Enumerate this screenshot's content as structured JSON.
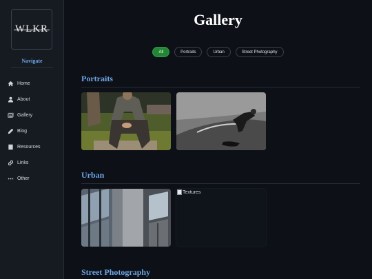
{
  "sidebar": {
    "logo_text": "WLKR",
    "nav_title": "Navigate",
    "items": [
      {
        "label": "Home",
        "icon": "home-icon"
      },
      {
        "label": "About",
        "icon": "user-icon"
      },
      {
        "label": "Gallery",
        "icon": "gallery-icon"
      },
      {
        "label": "Blog",
        "icon": "pencil-icon"
      },
      {
        "label": "Resources",
        "icon": "book-icon"
      },
      {
        "label": "Links",
        "icon": "link-icon"
      },
      {
        "label": "Other",
        "icon": "ellipsis-icon"
      }
    ]
  },
  "main": {
    "title": "Gallery",
    "filters": [
      {
        "label": "All",
        "active": true
      },
      {
        "label": "Portraits",
        "active": false
      },
      {
        "label": "Urban",
        "active": false
      },
      {
        "label": "Street Photography",
        "active": false
      }
    ],
    "sections": [
      {
        "title": "Portraits"
      },
      {
        "title": "Urban",
        "broken_image_alt": "Textures"
      },
      {
        "title": "Street Photography"
      }
    ]
  },
  "colors": {
    "background": "#0d1117",
    "sidebar": "#161b22",
    "accent_blue": "#6ea4e6",
    "active_filter": "#238636"
  }
}
